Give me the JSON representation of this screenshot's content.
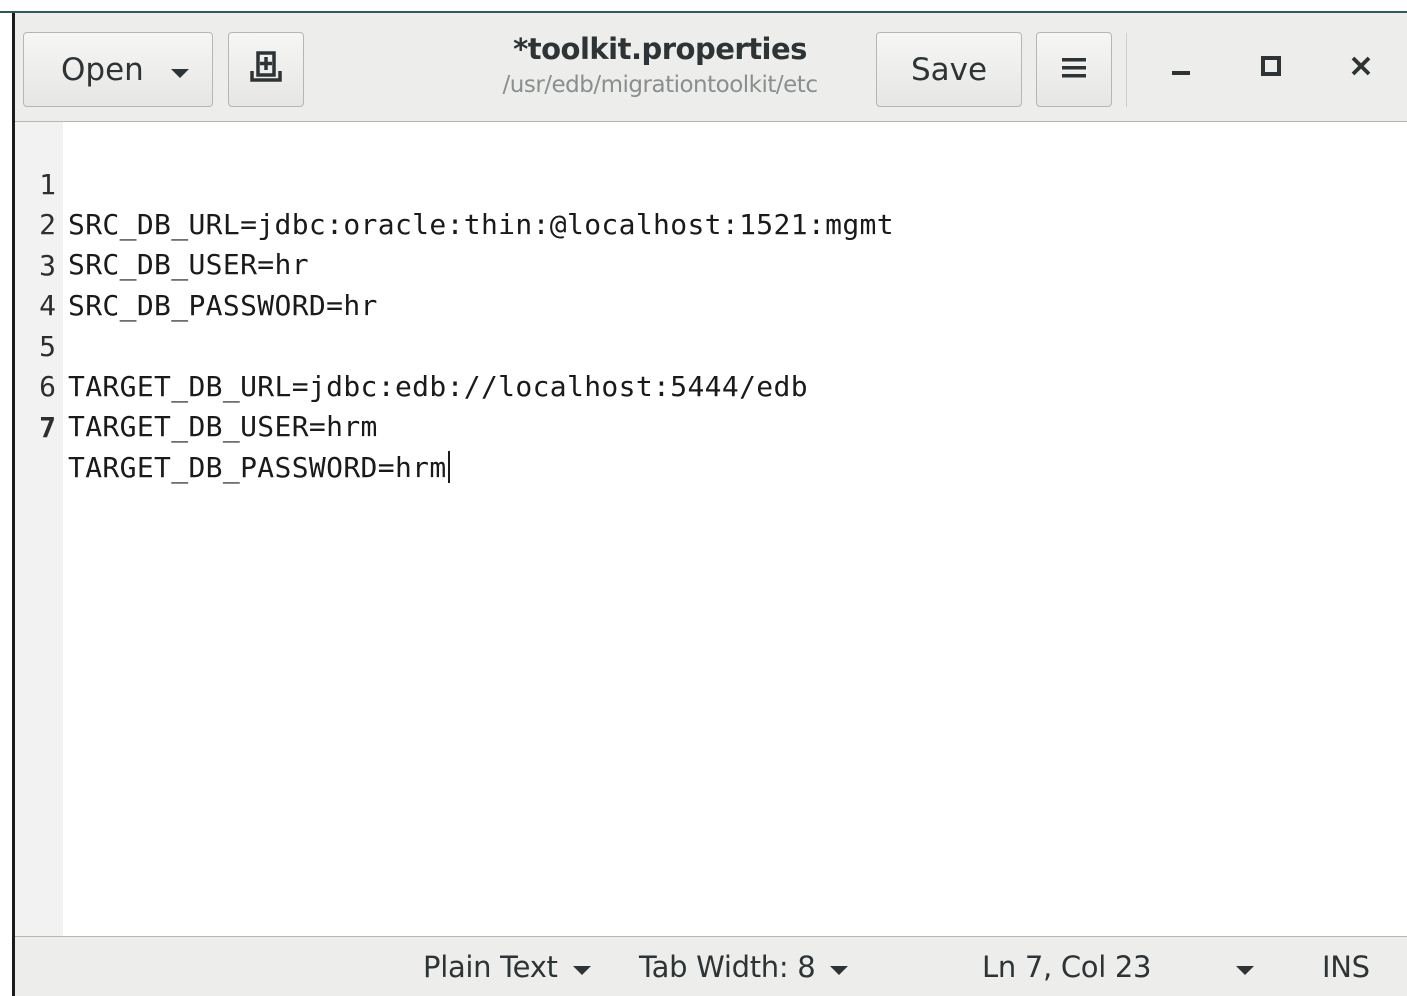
{
  "header": {
    "open_label": "Open",
    "title": "*toolkit.properties",
    "subtitle": "/usr/edb/migrationtoolkit/etc",
    "save_label": "Save"
  },
  "editor": {
    "lines": [
      {
        "number": "1",
        "text": "SRC_DB_URL=jdbc:oracle:thin:@localhost:1521:mgmt"
      },
      {
        "number": "2",
        "text": "SRC_DB_USER=hr"
      },
      {
        "number": "3",
        "text": "SRC_DB_PASSWORD=hr"
      },
      {
        "number": "4",
        "text": ""
      },
      {
        "number": "5",
        "text": "TARGET_DB_URL=jdbc:edb://localhost:5444/edb"
      },
      {
        "number": "6",
        "text": "TARGET_DB_USER=hrm"
      },
      {
        "number": "7",
        "text": "TARGET_DB_PASSWORD=hrm"
      }
    ],
    "current_line": "7"
  },
  "statusbar": {
    "language": "Plain Text",
    "tab_width": "Tab Width: 8",
    "position": "Ln 7, Col 23",
    "mode": "INS"
  },
  "icons": {
    "open_dropdown": "chevron-down-icon",
    "new_document": "new-document-icon",
    "menu": "hamburger-menu-icon",
    "minimize": "minimize-icon",
    "maximize": "maximize-icon",
    "close": "close-icon"
  },
  "colors": {
    "headerbar": "#ededec",
    "gutter": "#f2f2f2",
    "text": "#2e3436",
    "subtitle": "#8b8e8f"
  }
}
